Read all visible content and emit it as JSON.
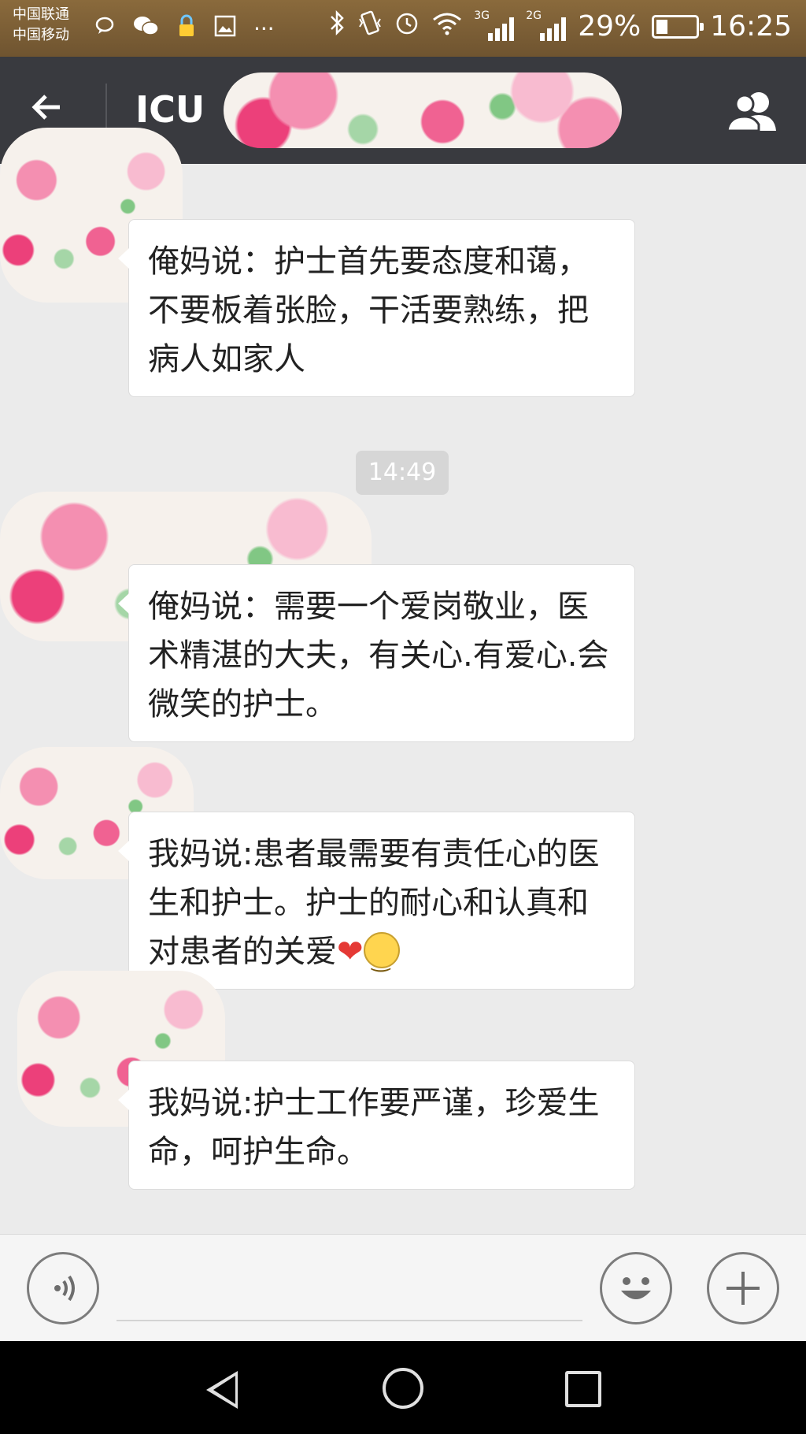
{
  "status_bar": {
    "carrier_1": "中国联通",
    "carrier_2": "中国移动",
    "network_1": "3G",
    "network_2": "2G",
    "battery": "29%",
    "battery_level": 0.29,
    "time": "16:25"
  },
  "header": {
    "title": "ICU",
    "back_icon": "arrow-left-icon",
    "members_icon": "group-members-icon"
  },
  "messages": [
    {
      "text": "俺妈说：护士首先要态度和蔼，不要板着张脸，干活要熟练，把病人如家人"
    },
    {
      "text": "俺妈说：需要一个爱岗敬业，医术精湛的大夫，有关心.有爱心.会微笑的护士。"
    },
    {
      "text": "我妈说:患者最需要有责任心的医生和护士。护士的耐心和认真和对患者的关爱"
    },
    {
      "text": "我妈说:护士工作要严谨，珍爱生命，呵护生命。"
    }
  ],
  "time_divider": "14:49",
  "input_bar": {
    "voice_icon": "voice-icon",
    "emoji_icon": "emoji-icon",
    "plus_icon": "plus-icon"
  },
  "nav_bar": {
    "back_icon": "nav-back-icon",
    "home_icon": "nav-home-icon",
    "recent_icon": "nav-recent-icon"
  }
}
